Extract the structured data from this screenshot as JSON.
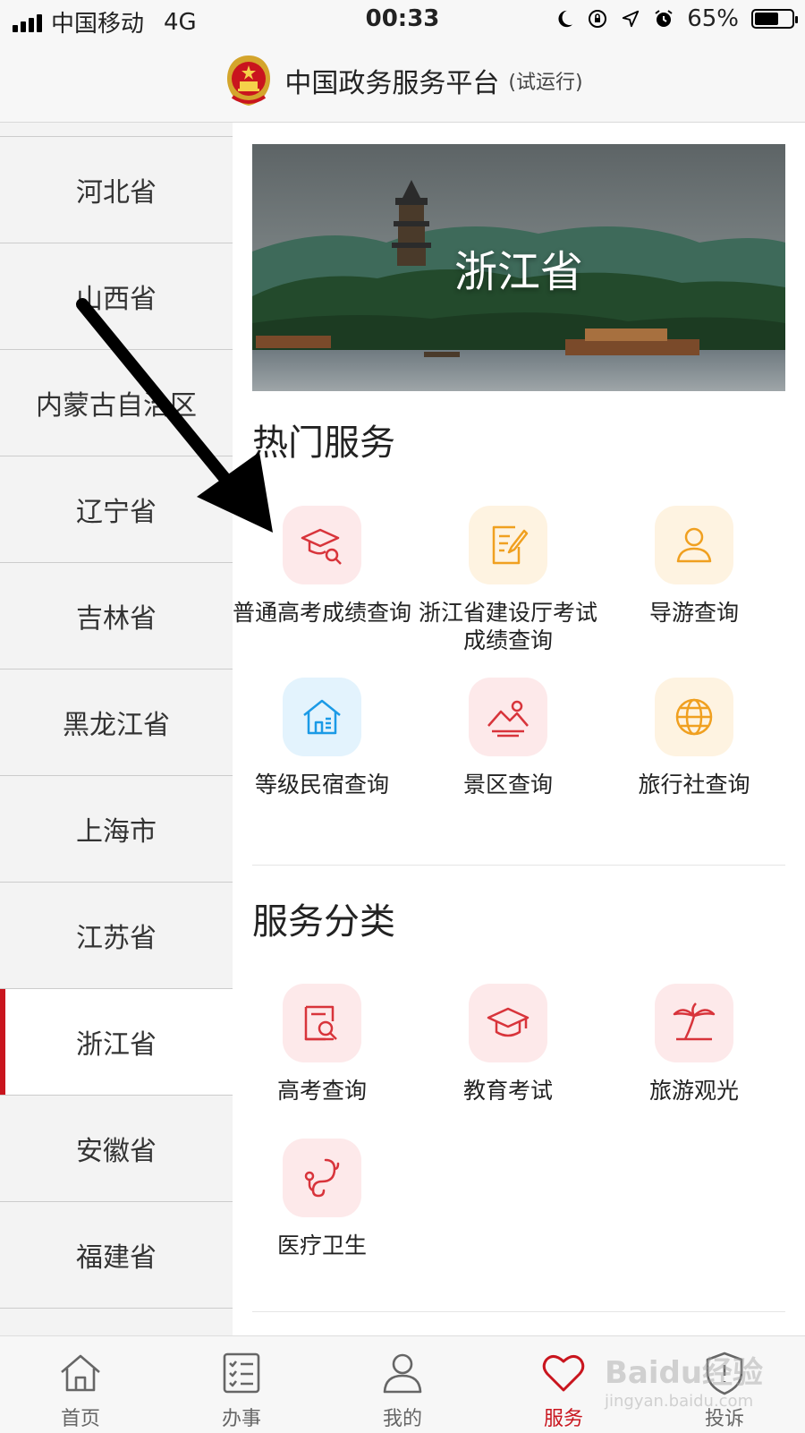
{
  "status_bar": {
    "carrier": "中国移动",
    "network": "4G",
    "time": "00:33",
    "battery": "65%",
    "battery_level": 0.65
  },
  "header": {
    "title": "中国政务服务平台",
    "subtitle": "(试运行)"
  },
  "sidebar": {
    "items": [
      {
        "label": "河北省"
      },
      {
        "label": "山西省"
      },
      {
        "label": "内蒙古自治区"
      },
      {
        "label": "辽宁省"
      },
      {
        "label": "吉林省"
      },
      {
        "label": "黑龙江省"
      },
      {
        "label": "上海市"
      },
      {
        "label": "江苏省"
      },
      {
        "label": "浙江省",
        "active": true
      },
      {
        "label": "安徽省"
      },
      {
        "label": "福建省"
      }
    ]
  },
  "banner": {
    "title": "浙江省"
  },
  "hot_services": {
    "title": "热门服务",
    "items": [
      {
        "label": "普通高考成绩查询",
        "icon": "graduation-search-icon",
        "color": "#d8343b"
      },
      {
        "label": "浙江省建设厅考试成绩查询",
        "icon": "edit-document-icon",
        "color": "#f0a020"
      },
      {
        "label": "导游查询",
        "icon": "person-icon",
        "color": "#f0a020"
      },
      {
        "label": "等级民宿查询",
        "icon": "house-icon",
        "color": "#1b9ae6"
      },
      {
        "label": "景区查询",
        "icon": "mountain-icon",
        "color": "#d8343b"
      },
      {
        "label": "旅行社查询",
        "icon": "globe-icon",
        "color": "#f0a020"
      }
    ]
  },
  "categories": {
    "title": "服务分类",
    "items": [
      {
        "label": "高考查询",
        "icon": "search-document-icon",
        "color": "#d8343b"
      },
      {
        "label": "教育考试",
        "icon": "graduation-cap-icon",
        "color": "#d8343b"
      },
      {
        "label": "旅游观光",
        "icon": "palm-tree-icon",
        "color": "#d8343b"
      },
      {
        "label": "医疗卫生",
        "icon": "stethoscope-icon",
        "color": "#d8343b"
      }
    ]
  },
  "tab_bar": {
    "items": [
      {
        "label": "首页",
        "icon": "home-icon"
      },
      {
        "label": "办事",
        "icon": "checklist-icon"
      },
      {
        "label": "我的",
        "icon": "user-icon"
      },
      {
        "label": "服务",
        "icon": "heart-icon",
        "active": true
      },
      {
        "label": "投诉",
        "icon": "shield-icon"
      }
    ]
  },
  "colors": {
    "accent": "#c9151e",
    "icon_red": "#d8343b",
    "icon_yellow": "#f0a020",
    "icon_blue": "#1b9ae6"
  },
  "watermark": {
    "text": "Baidu经验",
    "url_text": "jingyan.baidu.com"
  }
}
